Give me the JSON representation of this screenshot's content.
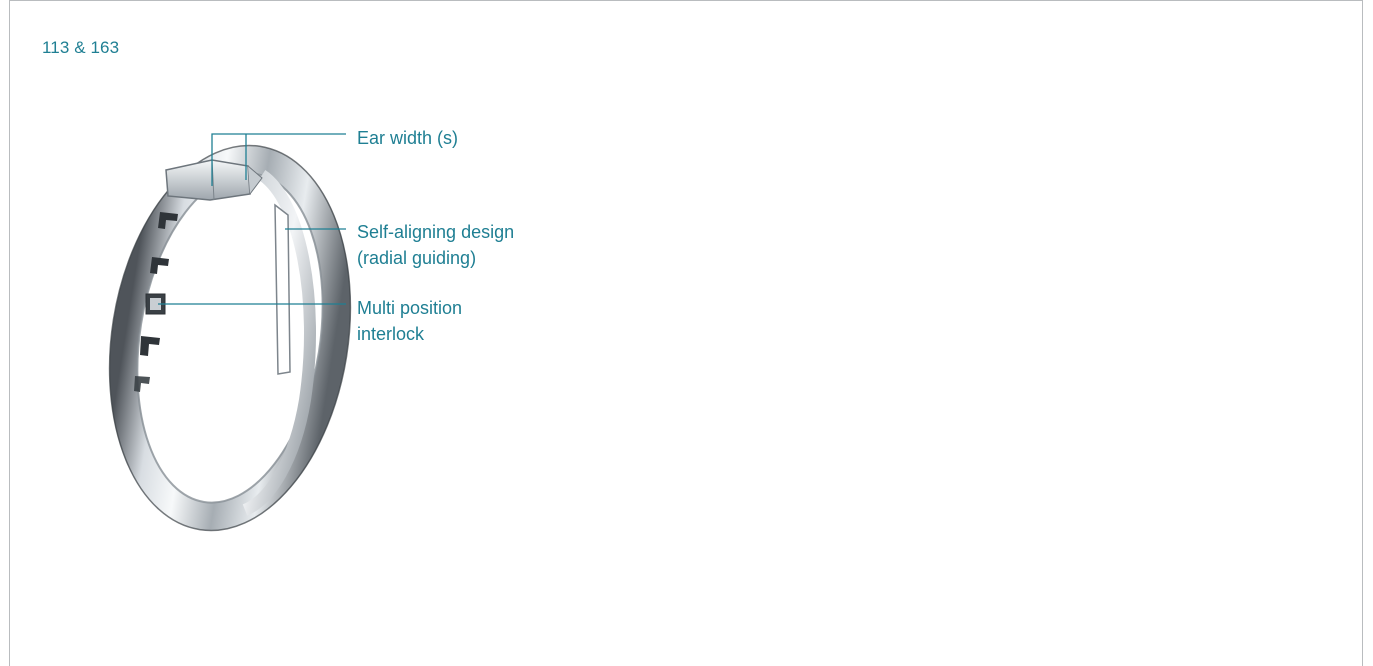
{
  "header": {
    "title": "113 & 163"
  },
  "callouts": {
    "ear_width": "Ear width (s)",
    "self_aligning": "Self-aligning design\n(radial guiding)",
    "multi_position": "Multi position\ninterlock"
  },
  "colors": {
    "accent": "#1f7f93",
    "border": "#b9bcbf"
  }
}
